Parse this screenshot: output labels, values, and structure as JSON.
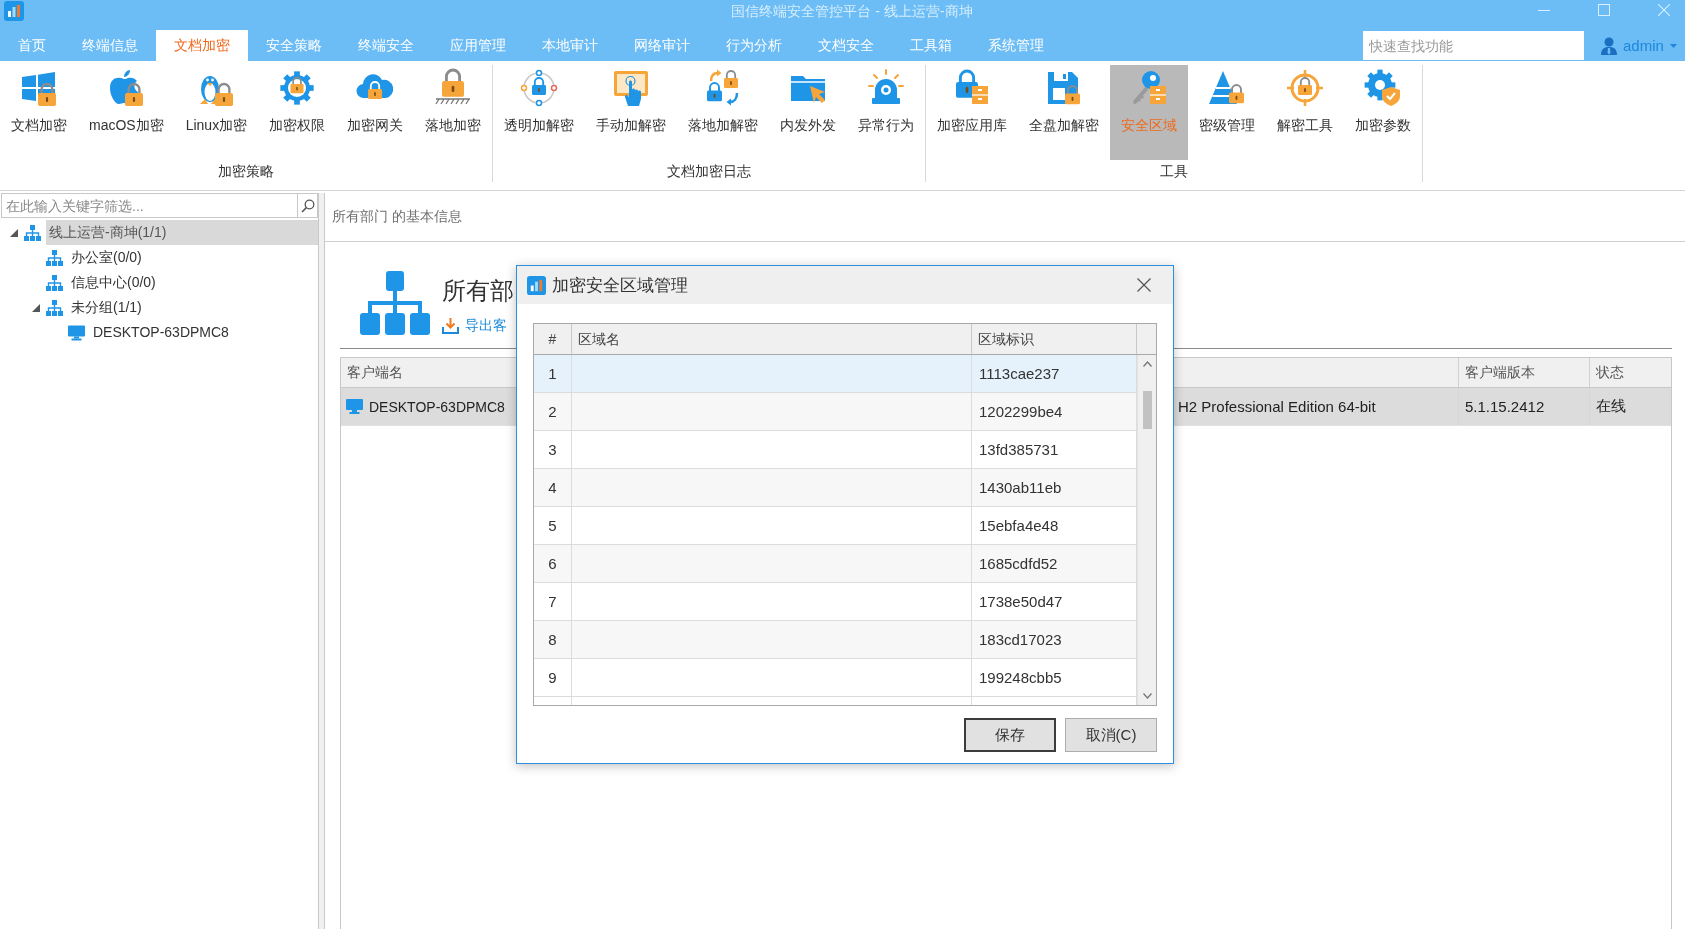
{
  "window": {
    "title": "国信终端安全管控平台 - 线上运营-商坤"
  },
  "menu_tabs": [
    {
      "label": "首页",
      "selected": false
    },
    {
      "label": "终端信息",
      "selected": false
    },
    {
      "label": "文档加密",
      "selected": true
    },
    {
      "label": "安全策略",
      "selected": false
    },
    {
      "label": "终端安全",
      "selected": false
    },
    {
      "label": "应用管理",
      "selected": false
    },
    {
      "label": "本地审计",
      "selected": false
    },
    {
      "label": "网络审计",
      "selected": false
    },
    {
      "label": "行为分析",
      "selected": false
    },
    {
      "label": "文档安全",
      "selected": false
    },
    {
      "label": "工具箱",
      "selected": false
    },
    {
      "label": "系统管理",
      "selected": false
    }
  ],
  "quick_search": {
    "placeholder": "快速查找功能"
  },
  "user": {
    "name": "admin"
  },
  "ribbon": {
    "groups": [
      {
        "label": "加密策略",
        "items": [
          {
            "label": "文档加密",
            "selected": false
          },
          {
            "label": "macOS加密",
            "selected": false
          },
          {
            "label": "Linux加密",
            "selected": false
          },
          {
            "label": "加密权限",
            "selected": false
          },
          {
            "label": "加密网关",
            "selected": false
          },
          {
            "label": "落地加密",
            "selected": false
          }
        ]
      },
      {
        "label": "文档加密日志",
        "items": [
          {
            "label": "透明加解密",
            "selected": false
          },
          {
            "label": "手动加解密",
            "selected": false
          },
          {
            "label": "落地加解密",
            "selected": false
          },
          {
            "label": "内发外发",
            "selected": false
          },
          {
            "label": "异常行为",
            "selected": false
          }
        ]
      },
      {
        "label": "工具",
        "items": [
          {
            "label": "加密应用库",
            "selected": false
          },
          {
            "label": "全盘加解密",
            "selected": false
          },
          {
            "label": "安全区域",
            "selected": true
          },
          {
            "label": "密级管理",
            "selected": false
          },
          {
            "label": "解密工具",
            "selected": false
          },
          {
            "label": "加密参数",
            "selected": false
          }
        ]
      }
    ]
  },
  "sidebar": {
    "filter": {
      "placeholder": "在此输入关键字筛选..."
    },
    "tree": [
      {
        "label": "线上运营-商坤(1/1)",
        "kind": "group",
        "selected": true,
        "expanded": true,
        "children": [
          {
            "label": "办公室(0/0)",
            "kind": "group",
            "selected": false
          },
          {
            "label": "信息中心(0/0)",
            "kind": "group",
            "selected": false
          },
          {
            "label": "未分组(1/1)",
            "kind": "group",
            "selected": false,
            "expanded": true,
            "children": [
              {
                "label": "DESKTOP-63DPMC8",
                "kind": "computer",
                "selected": false
              }
            ]
          }
        ]
      }
    ]
  },
  "content": {
    "breadcrumb": "所有部门 的基本信息",
    "heading": "所有部",
    "export_link": "导出客",
    "table": {
      "columns": [
        {
          "label": "客户端名"
        },
        {
          "label": "客户端版本"
        },
        {
          "label": "状态"
        }
      ],
      "rows": [
        {
          "client_name": "DESKTOP-63DPMC8",
          "column_2": "H2 Professional Edition 64-bit",
          "version": "5.1.15.2412",
          "status": "在线",
          "selected": true
        }
      ]
    }
  },
  "dialog": {
    "title": "加密安全区域管理",
    "table": {
      "columns": [
        {
          "label": "#"
        },
        {
          "label": "区域名"
        },
        {
          "label": "区域标识"
        }
      ],
      "rows": [
        {
          "index": "1",
          "zone_id": "1113cae237",
          "selected": true
        },
        {
          "index": "2",
          "zone_id": "1202299be4",
          "selected": false
        },
        {
          "index": "3",
          "zone_id": "13fd385731",
          "selected": false
        },
        {
          "index": "4",
          "zone_id": "1430ab11eb",
          "selected": false
        },
        {
          "index": "5",
          "zone_id": "15ebfa4e48",
          "selected": false
        },
        {
          "index": "6",
          "zone_id": "1685cdfd52",
          "selected": false
        },
        {
          "index": "7",
          "zone_id": "1738e50d47",
          "selected": false
        },
        {
          "index": "8",
          "zone_id": "183cd17023",
          "selected": false
        },
        {
          "index": "9",
          "zone_id": "199248cbb5",
          "selected": false
        }
      ]
    },
    "buttons": [
      {
        "label": "保存",
        "default": true
      },
      {
        "label": "取消(C)",
        "default": false
      }
    ]
  }
}
